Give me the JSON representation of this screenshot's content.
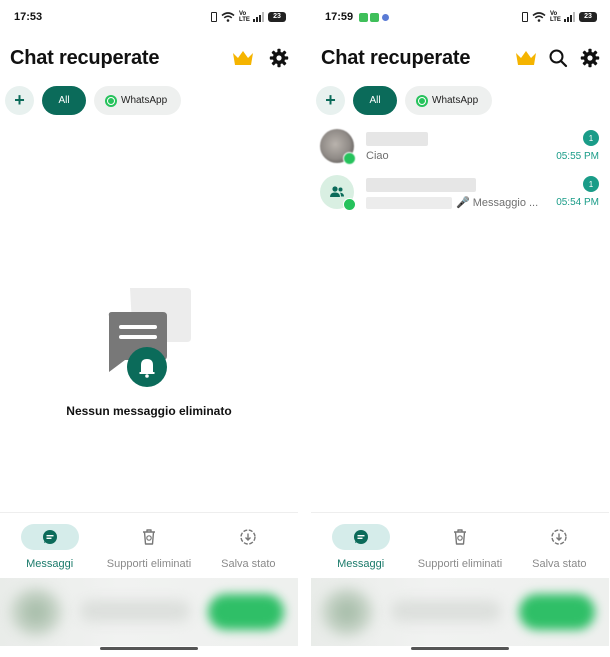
{
  "left_screen": {
    "status_bar": {
      "time": "17:53",
      "battery": "23"
    },
    "header": {
      "title": "Chat recuperate",
      "premium_icon": "crown-icon",
      "settings_icon": "gear-icon"
    },
    "filters": {
      "add_label": "+",
      "all_label": "All",
      "whatsapp_label": "WhatsApp"
    },
    "empty_state": {
      "message": "Nessun messaggio eliminato"
    },
    "bottom_nav": [
      {
        "label": "Messaggi",
        "icon": "chat-bubble-icon",
        "active": true
      },
      {
        "label": "Supporti eliminati",
        "icon": "trash-icon",
        "active": false
      },
      {
        "label": "Salva stato",
        "icon": "status-save-icon",
        "active": false
      }
    ]
  },
  "right_screen": {
    "status_bar": {
      "time": "17:59",
      "battery": "23"
    },
    "header": {
      "title": "Chat recuperate",
      "premium_icon": "crown-icon",
      "search_icon": "search-icon",
      "settings_icon": "gear-icon"
    },
    "filters": {
      "add_label": "+",
      "all_label": "All",
      "whatsapp_label": "WhatsApp"
    },
    "chats": [
      {
        "preview": "Ciao",
        "time": "05:55 PM",
        "unread": "1",
        "avatar": "photo"
      },
      {
        "preview": "🎤 Messaggio ...",
        "time": "05:54 PM",
        "unread": "1",
        "avatar": "group-icon"
      }
    ],
    "bottom_nav": [
      {
        "label": "Messaggi",
        "icon": "chat-bubble-icon",
        "active": true
      },
      {
        "label": "Supporti eliminati",
        "icon": "trash-icon",
        "active": false
      },
      {
        "label": "Salva stato",
        "icon": "status-save-icon",
        "active": false
      }
    ]
  },
  "colors": {
    "accent": "#0b6b5a",
    "teal": "#1a9c88",
    "whatsapp_green": "#26c25c",
    "crown": "#f5b400"
  }
}
